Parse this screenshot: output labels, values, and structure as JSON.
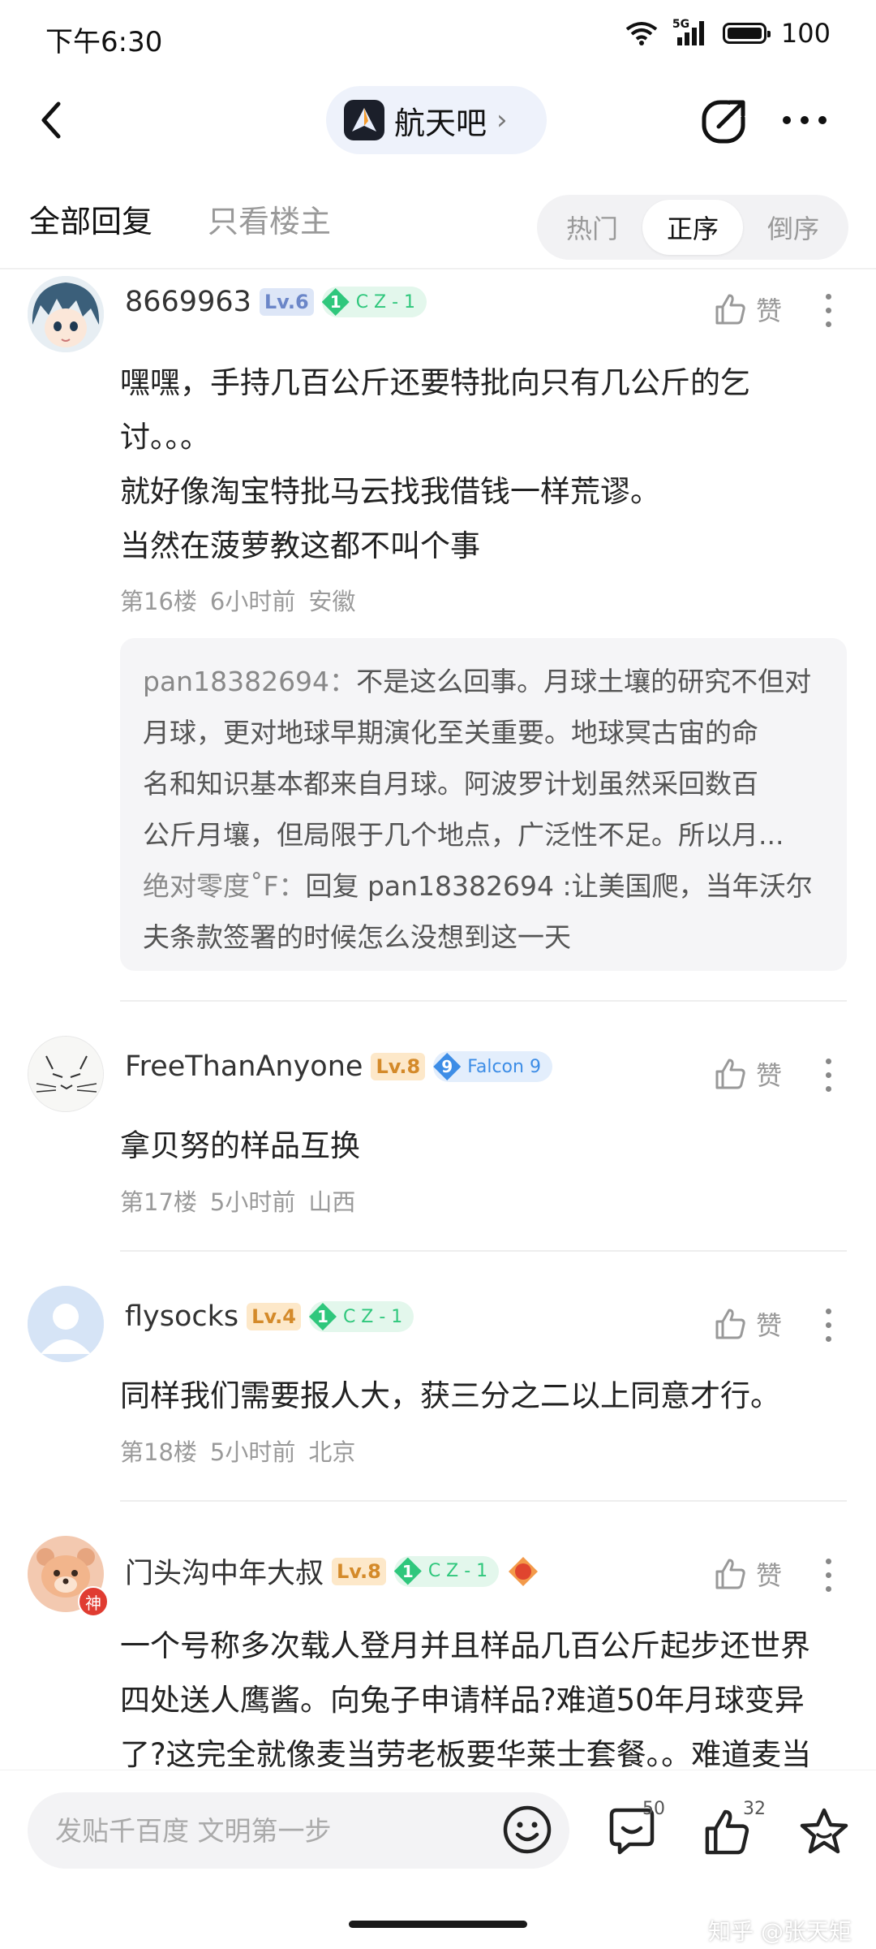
{
  "status": {
    "time": "下午6:30",
    "network": "5G",
    "battery": "100"
  },
  "header": {
    "forum_name": "航天吧",
    "chevron": "›"
  },
  "tabs": {
    "all": "全部回复",
    "owner": "只看楼主"
  },
  "sort": {
    "hot": "热门",
    "asc": "正序",
    "desc": "倒序",
    "active": "正序"
  },
  "posts": [
    {
      "username": "8669963",
      "level": "Lv.6",
      "title_num": "1",
      "title": "C Z - 1",
      "like_label": "赞",
      "lines": [
        "嘿嘿，手持几百公斤还要特批向只有几公斤的乞",
        "讨。。。",
        "就好像淘宝特批马云找我借钱一样荒谬。",
        "当然在菠萝教这都不叫个事"
      ],
      "floor": "第16楼",
      "time": "6小时前",
      "location": "安徽",
      "quotes": [
        {
          "user": "pan18382694：",
          "lines": [
            "不是这么回事。月球土壤的研究不但对",
            "月球，更对地球早期演化至关重要。地球冥古宙的命",
            "名和知识基本都来自月球。阿波罗计划虽然采回数百",
            "公斤月壤，但局限于几个地点，广泛性不足。所以月..."
          ]
        },
        {
          "user": "绝对零度˚F：",
          "lines": [
            "回复 pan18382694 :让美国爬，当年沃尔",
            "夫条款签署的时候怎么没想到这一天"
          ]
        }
      ]
    },
    {
      "username": "FreeThanAnyone",
      "level": "Lv.8",
      "title_num": "9",
      "title": "Falcon 9",
      "like_label": "赞",
      "lines": [
        "拿贝努的样品互换"
      ],
      "floor": "第17楼",
      "time": "5小时前",
      "location": "山西"
    },
    {
      "username": "flysocks",
      "level": "Lv.4",
      "title_num": "1",
      "title": "C Z - 1",
      "like_label": "赞",
      "lines": [
        "同样我们需要报人大，获三分之二以上同意才行。"
      ],
      "floor": "第18楼",
      "time": "5小时前",
      "location": "北京"
    },
    {
      "username": "门头沟中年大叔",
      "level": "Lv.8",
      "title_num": "1",
      "title": "C Z - 1",
      "avatar_badge": "神",
      "like_label": "赞",
      "lines": [
        "一个号称多次载人登月并且样品几百公斤起步还世界",
        "四处送人鹰酱。向兔子申请样品?难道50年月球变异",
        "了?这完全就像麦当劳老板要华莱士套餐。。难道麦当"
      ]
    }
  ],
  "bottom": {
    "placeholder": "发贴千百度 文明第一步",
    "comment_count": "50",
    "like_count": "32"
  },
  "watermark": "知乎 @张天矩",
  "colors": {
    "lv_blue_bg": "#dde6f7",
    "lv_blue_fg": "#6b86c8",
    "lv_orange_bg": "#fde8c9",
    "lv_orange_fg": "#d48a2a",
    "cz_green_bg": "#e3f7ec",
    "cz_green_fg": "#2fc77c",
    "falcon_bg": "#e3eefc",
    "falcon_fg": "#3d8de6"
  }
}
